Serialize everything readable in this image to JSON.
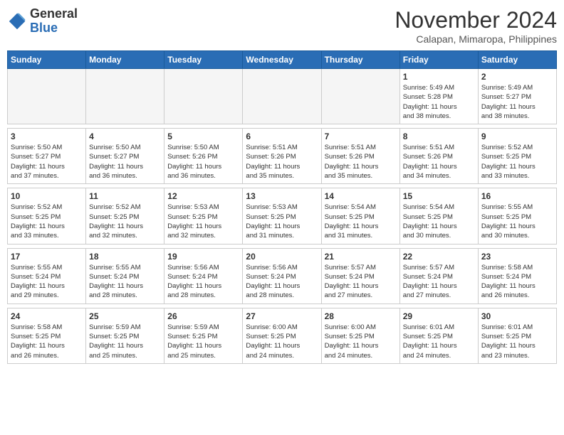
{
  "header": {
    "logo_line1": "General",
    "logo_line2": "Blue",
    "month": "November 2024",
    "location": "Calapan, Mimaropa, Philippines"
  },
  "weekdays": [
    "Sunday",
    "Monday",
    "Tuesday",
    "Wednesday",
    "Thursday",
    "Friday",
    "Saturday"
  ],
  "weeks": [
    [
      {
        "day": "",
        "info": ""
      },
      {
        "day": "",
        "info": ""
      },
      {
        "day": "",
        "info": ""
      },
      {
        "day": "",
        "info": ""
      },
      {
        "day": "",
        "info": ""
      },
      {
        "day": "1",
        "info": "Sunrise: 5:49 AM\nSunset: 5:28 PM\nDaylight: 11 hours\nand 38 minutes."
      },
      {
        "day": "2",
        "info": "Sunrise: 5:49 AM\nSunset: 5:27 PM\nDaylight: 11 hours\nand 38 minutes."
      }
    ],
    [
      {
        "day": "3",
        "info": "Sunrise: 5:50 AM\nSunset: 5:27 PM\nDaylight: 11 hours\nand 37 minutes."
      },
      {
        "day": "4",
        "info": "Sunrise: 5:50 AM\nSunset: 5:27 PM\nDaylight: 11 hours\nand 36 minutes."
      },
      {
        "day": "5",
        "info": "Sunrise: 5:50 AM\nSunset: 5:26 PM\nDaylight: 11 hours\nand 36 minutes."
      },
      {
        "day": "6",
        "info": "Sunrise: 5:51 AM\nSunset: 5:26 PM\nDaylight: 11 hours\nand 35 minutes."
      },
      {
        "day": "7",
        "info": "Sunrise: 5:51 AM\nSunset: 5:26 PM\nDaylight: 11 hours\nand 35 minutes."
      },
      {
        "day": "8",
        "info": "Sunrise: 5:51 AM\nSunset: 5:26 PM\nDaylight: 11 hours\nand 34 minutes."
      },
      {
        "day": "9",
        "info": "Sunrise: 5:52 AM\nSunset: 5:25 PM\nDaylight: 11 hours\nand 33 minutes."
      }
    ],
    [
      {
        "day": "10",
        "info": "Sunrise: 5:52 AM\nSunset: 5:25 PM\nDaylight: 11 hours\nand 33 minutes."
      },
      {
        "day": "11",
        "info": "Sunrise: 5:52 AM\nSunset: 5:25 PM\nDaylight: 11 hours\nand 32 minutes."
      },
      {
        "day": "12",
        "info": "Sunrise: 5:53 AM\nSunset: 5:25 PM\nDaylight: 11 hours\nand 32 minutes."
      },
      {
        "day": "13",
        "info": "Sunrise: 5:53 AM\nSunset: 5:25 PM\nDaylight: 11 hours\nand 31 minutes."
      },
      {
        "day": "14",
        "info": "Sunrise: 5:54 AM\nSunset: 5:25 PM\nDaylight: 11 hours\nand 31 minutes."
      },
      {
        "day": "15",
        "info": "Sunrise: 5:54 AM\nSunset: 5:25 PM\nDaylight: 11 hours\nand 30 minutes."
      },
      {
        "day": "16",
        "info": "Sunrise: 5:55 AM\nSunset: 5:25 PM\nDaylight: 11 hours\nand 30 minutes."
      }
    ],
    [
      {
        "day": "17",
        "info": "Sunrise: 5:55 AM\nSunset: 5:24 PM\nDaylight: 11 hours\nand 29 minutes."
      },
      {
        "day": "18",
        "info": "Sunrise: 5:55 AM\nSunset: 5:24 PM\nDaylight: 11 hours\nand 28 minutes."
      },
      {
        "day": "19",
        "info": "Sunrise: 5:56 AM\nSunset: 5:24 PM\nDaylight: 11 hours\nand 28 minutes."
      },
      {
        "day": "20",
        "info": "Sunrise: 5:56 AM\nSunset: 5:24 PM\nDaylight: 11 hours\nand 28 minutes."
      },
      {
        "day": "21",
        "info": "Sunrise: 5:57 AM\nSunset: 5:24 PM\nDaylight: 11 hours\nand 27 minutes."
      },
      {
        "day": "22",
        "info": "Sunrise: 5:57 AM\nSunset: 5:24 PM\nDaylight: 11 hours\nand 27 minutes."
      },
      {
        "day": "23",
        "info": "Sunrise: 5:58 AM\nSunset: 5:24 PM\nDaylight: 11 hours\nand 26 minutes."
      }
    ],
    [
      {
        "day": "24",
        "info": "Sunrise: 5:58 AM\nSunset: 5:25 PM\nDaylight: 11 hours\nand 26 minutes."
      },
      {
        "day": "25",
        "info": "Sunrise: 5:59 AM\nSunset: 5:25 PM\nDaylight: 11 hours\nand 25 minutes."
      },
      {
        "day": "26",
        "info": "Sunrise: 5:59 AM\nSunset: 5:25 PM\nDaylight: 11 hours\nand 25 minutes."
      },
      {
        "day": "27",
        "info": "Sunrise: 6:00 AM\nSunset: 5:25 PM\nDaylight: 11 hours\nand 24 minutes."
      },
      {
        "day": "28",
        "info": "Sunrise: 6:00 AM\nSunset: 5:25 PM\nDaylight: 11 hours\nand 24 minutes."
      },
      {
        "day": "29",
        "info": "Sunrise: 6:01 AM\nSunset: 5:25 PM\nDaylight: 11 hours\nand 24 minutes."
      },
      {
        "day": "30",
        "info": "Sunrise: 6:01 AM\nSunset: 5:25 PM\nDaylight: 11 hours\nand 23 minutes."
      }
    ]
  ]
}
